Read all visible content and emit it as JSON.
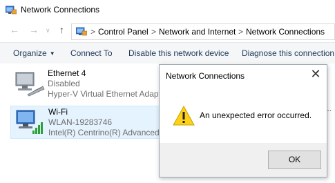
{
  "window": {
    "title": "Network Connections",
    "app_icon": "network-folder-icon"
  },
  "address_bar": {
    "back_icon": "back-arrow-icon",
    "forward_icon": "forward-arrow-icon",
    "recent_icon": "chevron-down-icon",
    "up_icon": "up-arrow-icon",
    "separator": ">",
    "crumbs": [
      "Control Panel",
      "Network and Internet",
      "Network Connections"
    ]
  },
  "command_bar": {
    "items": [
      "Organize",
      "Connect To",
      "Disable this network device",
      "Diagnose this connection"
    ]
  },
  "connections": [
    {
      "name": "Ethernet 4",
      "status": "Disabled",
      "device": "Hyper-V Virtual Ethernet Adapte",
      "icon": "ethernet-adapter-icon",
      "selected": false
    },
    {
      "name": "Wi-Fi",
      "status": "WLAN-19283746",
      "device": "Intel(R) Centrino(R) Advanced-N",
      "icon": "wifi-adapter-icon",
      "selected": true
    }
  ],
  "truncated_text": "r ...",
  "dialog": {
    "title": "Network Connections",
    "message": "An unexpected error occurred.",
    "ok_label": "OK",
    "close_glyph": "✕",
    "icon": "warning-icon"
  },
  "colors": {
    "accent_text": "#1e395b",
    "selection_bg": "#e5f3ff",
    "warning_yellow": "#fcd116"
  }
}
